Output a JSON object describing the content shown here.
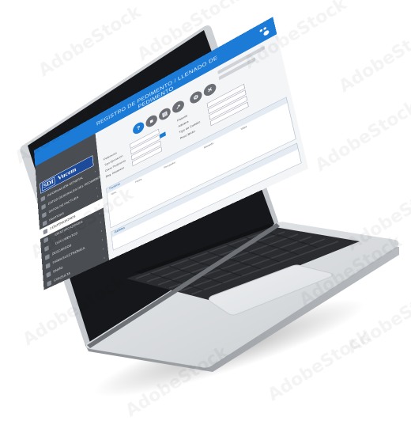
{
  "watermark": {
    "text": "AdobeStock"
  },
  "screen_ui": {
    "window": {
      "title": "REGISTRO DE PEDIMENTO / LLENADO DE PEDIMENTO"
    },
    "logo": {
      "mark": "SDI",
      "name": "Vucem"
    },
    "sidebar": {
      "items": [
        {
          "label": "INFORMACIÓN GENERAL"
        },
        {
          "label": "DATOS GENERALES DEL PEDIMENTO"
        },
        {
          "label": "DATOS DE FACTURA"
        },
        {
          "label": "PARTIDAS"
        },
        {
          "label": "CONTENEDORES"
        },
        {
          "label": "IDENTIFICADORES"
        },
        {
          "label": "DOCUMENTOS"
        },
        {
          "label": "DESCARGOS"
        },
        {
          "label": "FIRMA ELECTRÓNICA"
        },
        {
          "label": "ENVÍO"
        },
        {
          "label": "CONSULTA"
        }
      ]
    },
    "form": {
      "labels": [
        "Pedimento",
        "Tipo Operación",
        "Clave Pedimento",
        "Reg. Aduanero",
        "Patente",
        "Aduana",
        "Tipo de Cambio",
        "Peso Bruto"
      ],
      "panel_title": "Facturas",
      "columns": [
        "Núm.",
        "Fecha",
        "Proveedor",
        "Moneda",
        "Valor"
      ],
      "panel2_title": "Partidas"
    }
  }
}
